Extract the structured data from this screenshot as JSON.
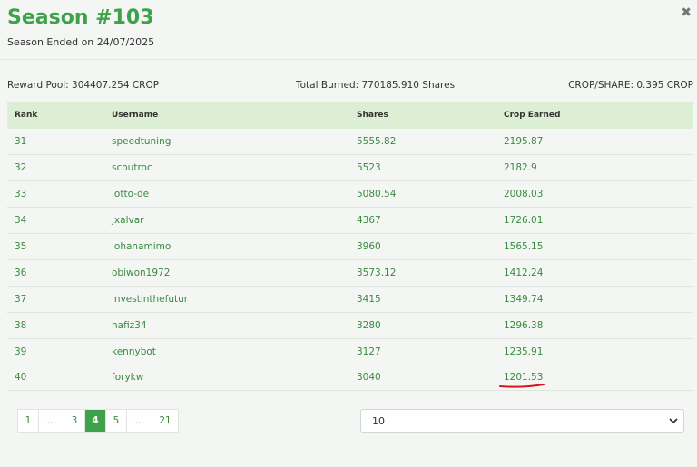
{
  "header": {
    "title": "Season #103",
    "subtitle": "Season Ended on 24/07/2025",
    "close_glyph": "✖"
  },
  "stats": {
    "reward_pool": "Reward Pool: 304407.254 CROP",
    "total_burned": "Total Burned: 770185.910 Shares",
    "crop_per_share": "CROP/SHARE: 0.395 CROP"
  },
  "table": {
    "columns": [
      "Rank",
      "Username",
      "Shares",
      "Crop Earned"
    ],
    "rows": [
      {
        "rank": "31",
        "username": "speedtuning",
        "shares": "5555.82",
        "crop": "2195.87"
      },
      {
        "rank": "32",
        "username": "scoutroc",
        "shares": "5523",
        "crop": "2182.9"
      },
      {
        "rank": "33",
        "username": "lotto-de",
        "shares": "5080.54",
        "crop": "2008.03"
      },
      {
        "rank": "34",
        "username": "jxalvar",
        "shares": "4367",
        "crop": "1726.01"
      },
      {
        "rank": "35",
        "username": "lohanamimo",
        "shares": "3960",
        "crop": "1565.15"
      },
      {
        "rank": "36",
        "username": "obiwon1972",
        "shares": "3573.12",
        "crop": "1412.24"
      },
      {
        "rank": "37",
        "username": "investinthefutur",
        "shares": "3415",
        "crop": "1349.74"
      },
      {
        "rank": "38",
        "username": "hafiz34",
        "shares": "3280",
        "crop": "1296.38"
      },
      {
        "rank": "39",
        "username": "kennybot",
        "shares": "3127",
        "crop": "1235.91"
      },
      {
        "rank": "40",
        "username": "forykw",
        "shares": "3040",
        "crop": "1201.53"
      }
    ]
  },
  "pagination": {
    "pages": [
      "1",
      "...",
      "3",
      "4",
      "5",
      "...",
      "21"
    ],
    "active": "4"
  },
  "page_size": {
    "selected": "10"
  },
  "colors": {
    "accent": "#3fa24a",
    "header_row": "#dcefd5",
    "highlight_underline": "#d9121e"
  }
}
